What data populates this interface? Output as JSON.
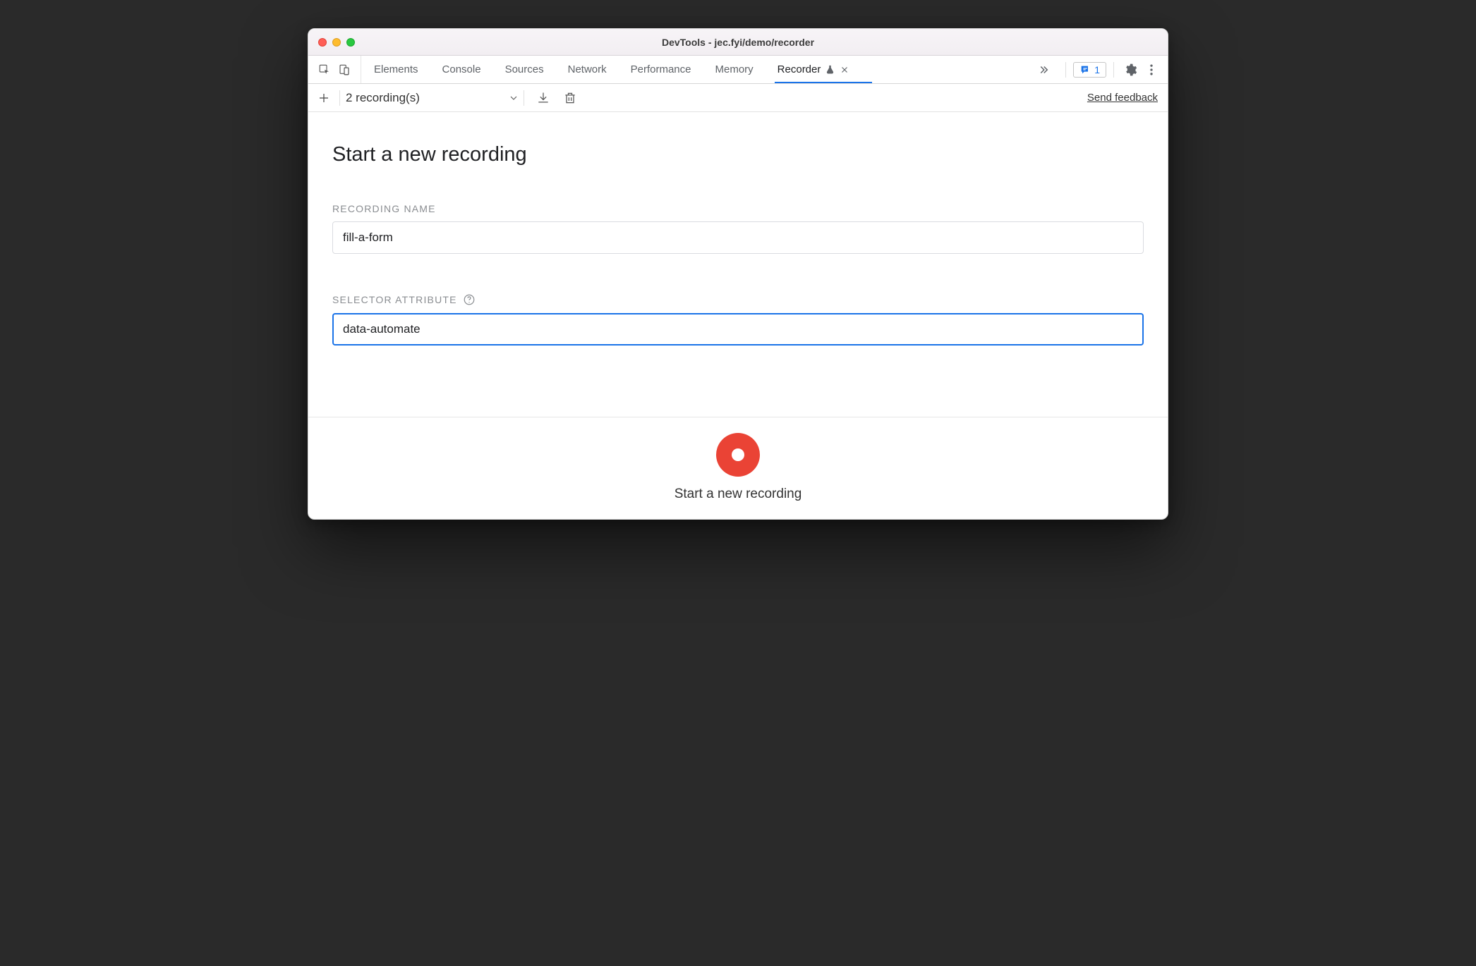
{
  "window": {
    "title": "DevTools - jec.fyi/demo/recorder"
  },
  "tabs": {
    "items": [
      {
        "label": "Elements",
        "active": false
      },
      {
        "label": "Console",
        "active": false
      },
      {
        "label": "Sources",
        "active": false
      },
      {
        "label": "Network",
        "active": false
      },
      {
        "label": "Performance",
        "active": false
      },
      {
        "label": "Memory",
        "active": false
      },
      {
        "label": "Recorder",
        "active": true,
        "experimental": true,
        "closeable": true
      }
    ]
  },
  "issues": {
    "count": "1"
  },
  "subbar": {
    "recordings_label": "2 recording(s)"
  },
  "feedback_link": "Send feedback",
  "main": {
    "heading": "Start a new recording",
    "recording_name": {
      "label": "RECORDING NAME",
      "value": "fill-a-form"
    },
    "selector_attribute": {
      "label": "SELECTOR ATTRIBUTE",
      "value": "data-automate"
    }
  },
  "footer": {
    "label": "Start a new recording"
  },
  "colors": {
    "accent": "#1a73e8",
    "record": "#ea4335"
  }
}
